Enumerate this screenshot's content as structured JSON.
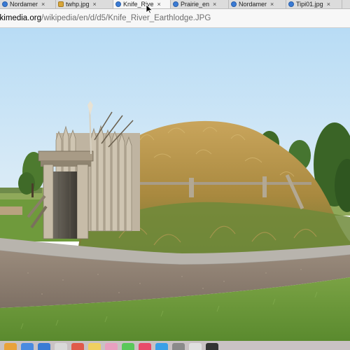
{
  "browser": {
    "tabs": [
      {
        "label": "Nordamer",
        "icon": "wikipedia-globe-icon",
        "active": false
      },
      {
        "label": "twhp.jpg",
        "icon": "image-file-icon",
        "active": false
      },
      {
        "label": "Knife_Rive",
        "icon": "wikipedia-globe-icon",
        "active": true
      },
      {
        "label": "Prairie_en",
        "icon": "wikipedia-globe-icon",
        "active": false
      },
      {
        "label": "Nordamer",
        "icon": "wikipedia-globe-icon",
        "active": false
      },
      {
        "label": "Tipi01.jpg",
        "icon": "wikipedia-globe-icon",
        "active": false
      }
    ],
    "close_glyph": "×",
    "address": {
      "host": "ikimedia.org",
      "path": "/wikipedia/en/d/d5/Knife_River_Earthlodge.JPG"
    }
  },
  "image": {
    "subject": "earthlodge-photo",
    "colors": {
      "sky": "#c9e4f6",
      "grass": "#c9a85a",
      "lawn": "#6f9a3c",
      "path": "#b8b4ad",
      "gravel": "#8c7f72",
      "wood": "#b7ad9c"
    }
  },
  "dock": {
    "icons": [
      "finder-icon",
      "launchpad-icon",
      "safari-icon",
      "mail-icon",
      "calendar-icon",
      "notes-icon",
      "photos-icon",
      "messages-icon",
      "music-icon",
      "appstore-icon",
      "settings-icon",
      "chrome-icon",
      "terminal-icon"
    ],
    "colors": [
      "#e9a23b",
      "#4a8be0",
      "#3a7bd5",
      "#d9d9d9",
      "#e05a4a",
      "#f0d060",
      "#e8a0c0",
      "#5ac85a",
      "#e84a6a",
      "#3aa0e8",
      "#8a8a8a",
      "#e0e0e0",
      "#333333"
    ]
  }
}
